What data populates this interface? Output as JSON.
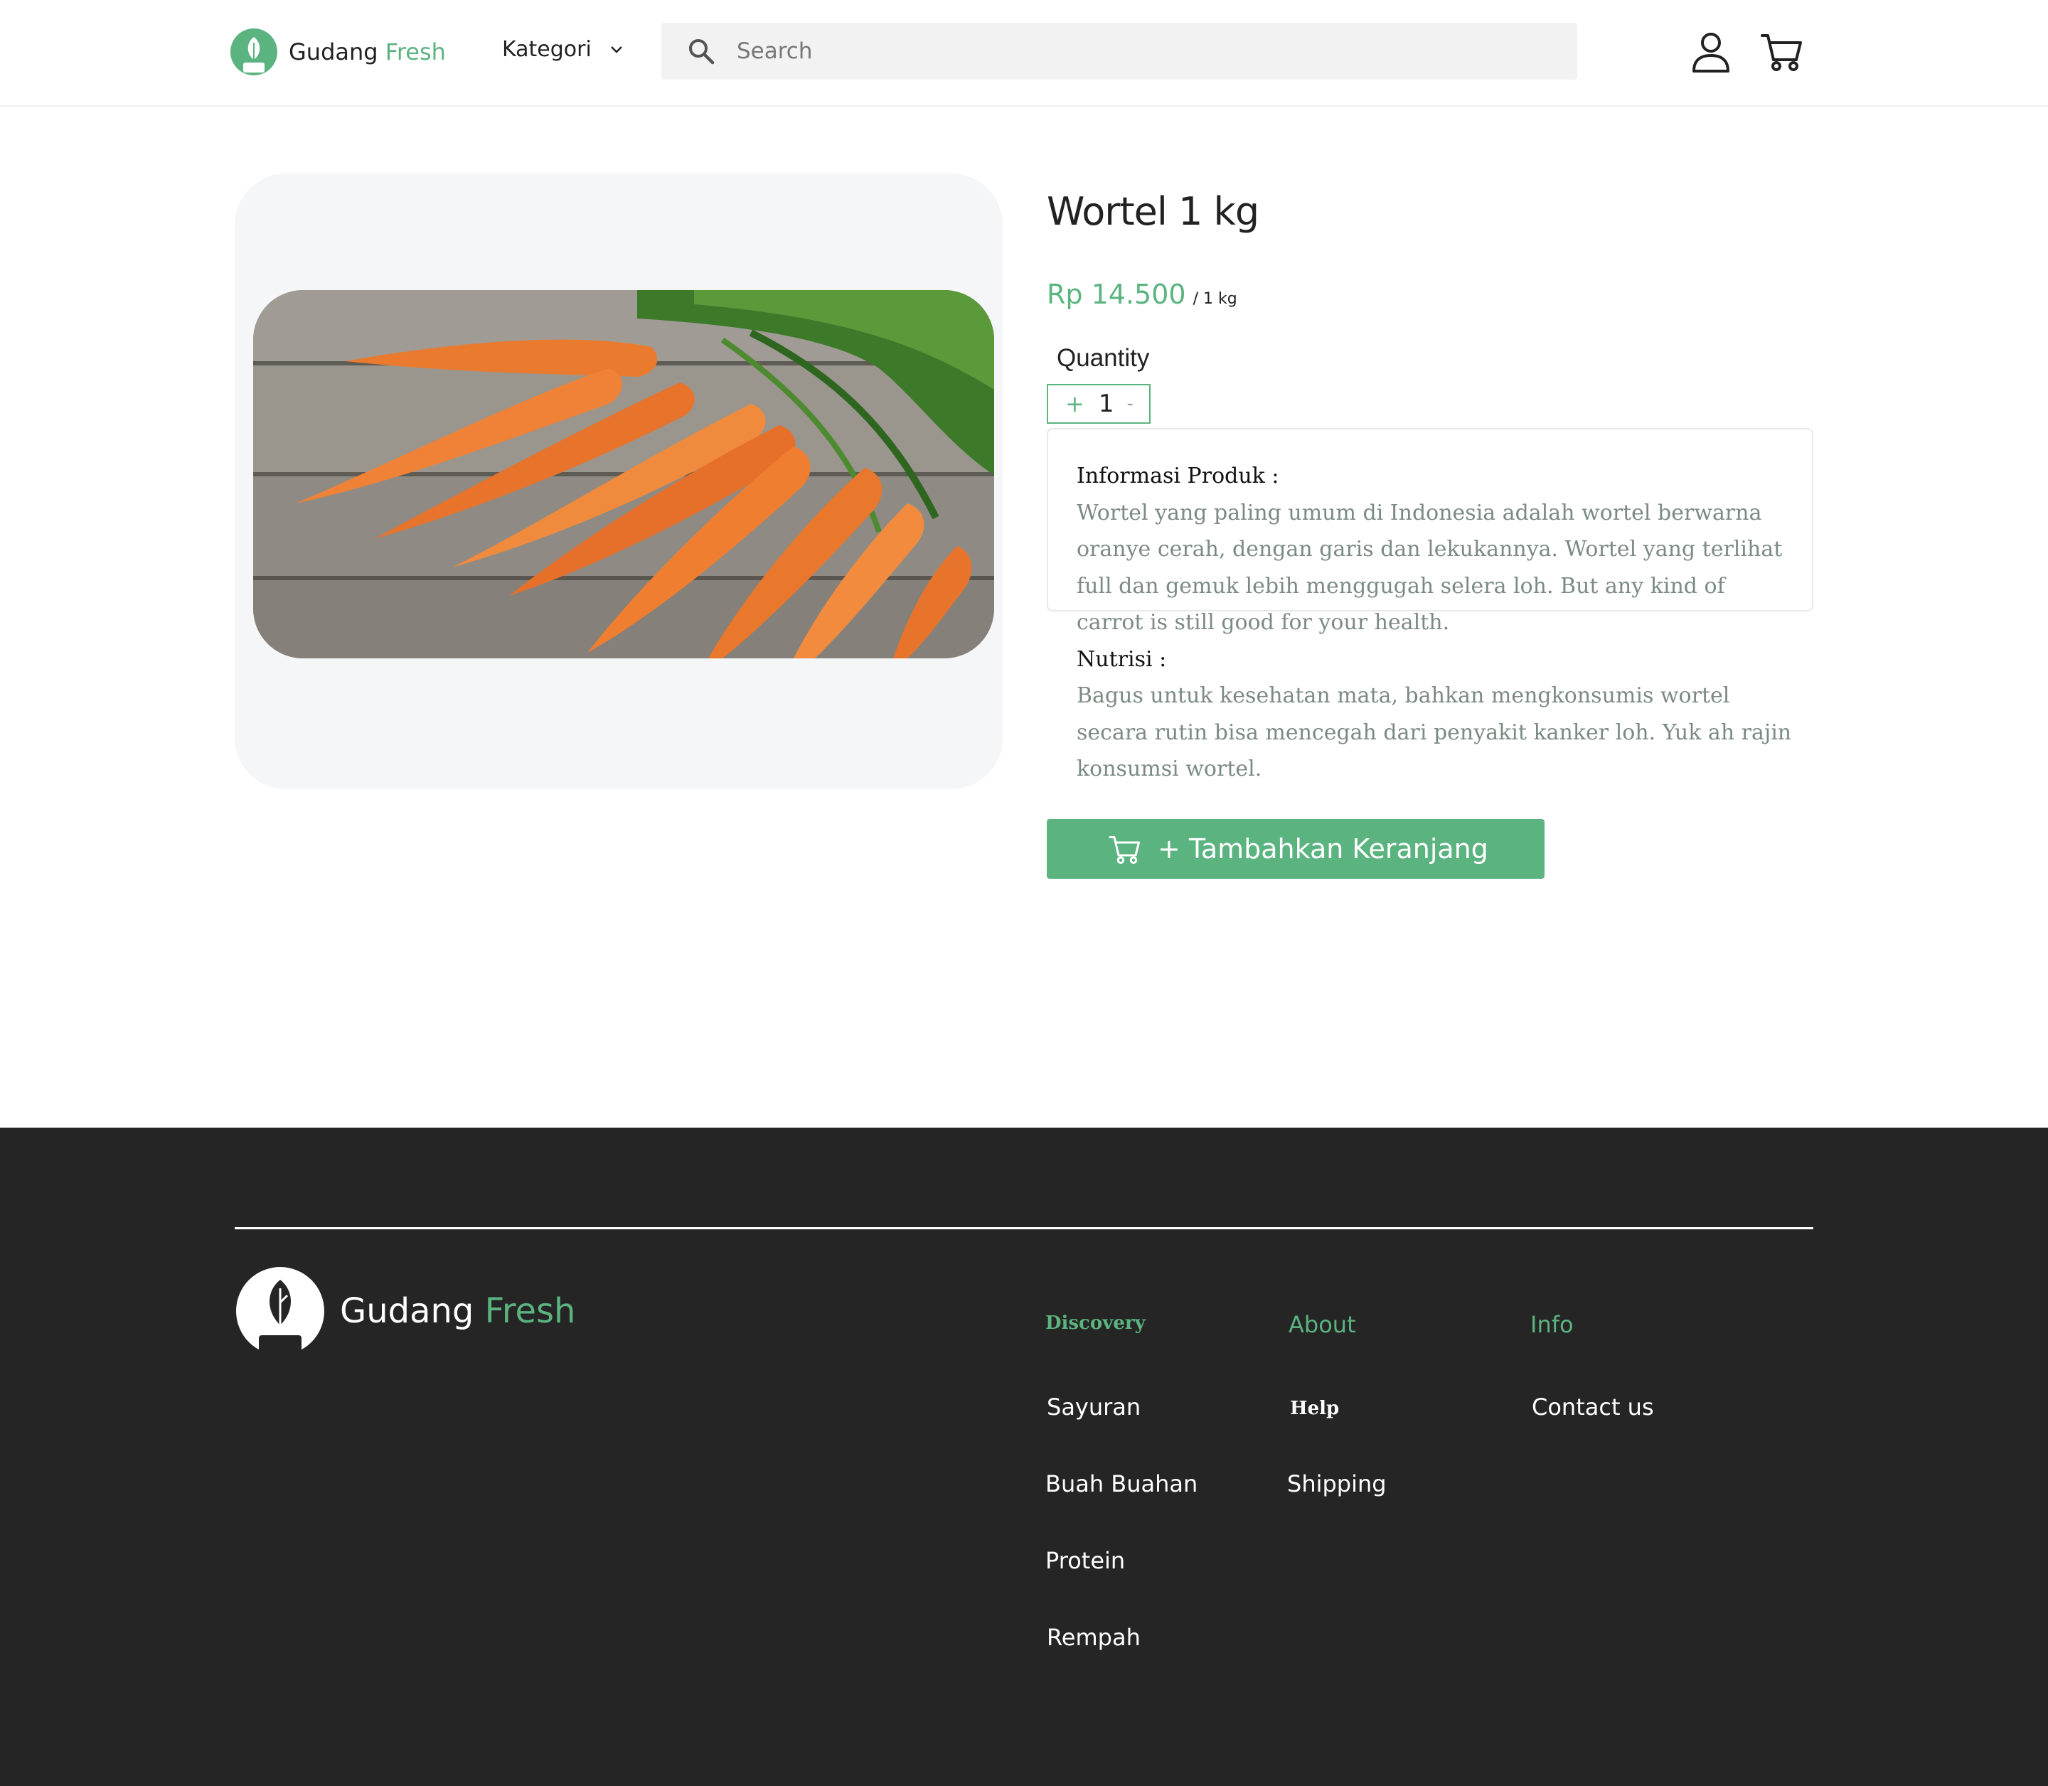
{
  "colors": {
    "brand_green": "#5bb480",
    "footer_bg": "#252525",
    "card_bg": "#f5f6f8"
  },
  "header": {
    "logo": {
      "name": "Gudang",
      "accent": "Fresh"
    },
    "kategori_label": "Kategori",
    "search": {
      "placeholder": "Search",
      "value": ""
    },
    "icons": [
      "search-icon",
      "user-icon",
      "cart-icon",
      "chevron-down-icon"
    ]
  },
  "product": {
    "title": "Wortel 1 kg",
    "price": "Rp 14.500",
    "unit": "/ 1 kg",
    "quantity_label": "Quantity",
    "quantity": {
      "plus": "+",
      "value": "1",
      "minus": "-"
    },
    "info_heading": "Informasi Produk :",
    "info_text": "Wortel yang paling umum di Indonesia adalah wortel berwarna oranye cerah, dengan garis dan lekukannya. Wortel yang terlihat full dan gemuk lebih menggugah selera loh. But any kind of carrot is still good for your health.",
    "nutrition_heading": "Nutrisi :",
    "nutrition_text": "Bagus untuk kesehatan mata, bahkan mengkonsumis wortel secara rutin bisa mencegah dari penyakit kanker loh. Yuk ah rajin konsumsi wortel.",
    "add_to_cart_label": "+ Tambahkan Keranjang"
  },
  "footer": {
    "logo": {
      "name": "Gudang",
      "accent": "Fresh"
    },
    "discovery": {
      "heading": "Discovery",
      "items": [
        "Sayuran",
        "Buah Buahan",
        "Protein",
        "Rempah"
      ]
    },
    "about": {
      "heading": "About",
      "items": [
        "Help",
        "Shipping"
      ]
    },
    "info": {
      "heading": "Info",
      "items": [
        "Contact us"
      ]
    }
  }
}
